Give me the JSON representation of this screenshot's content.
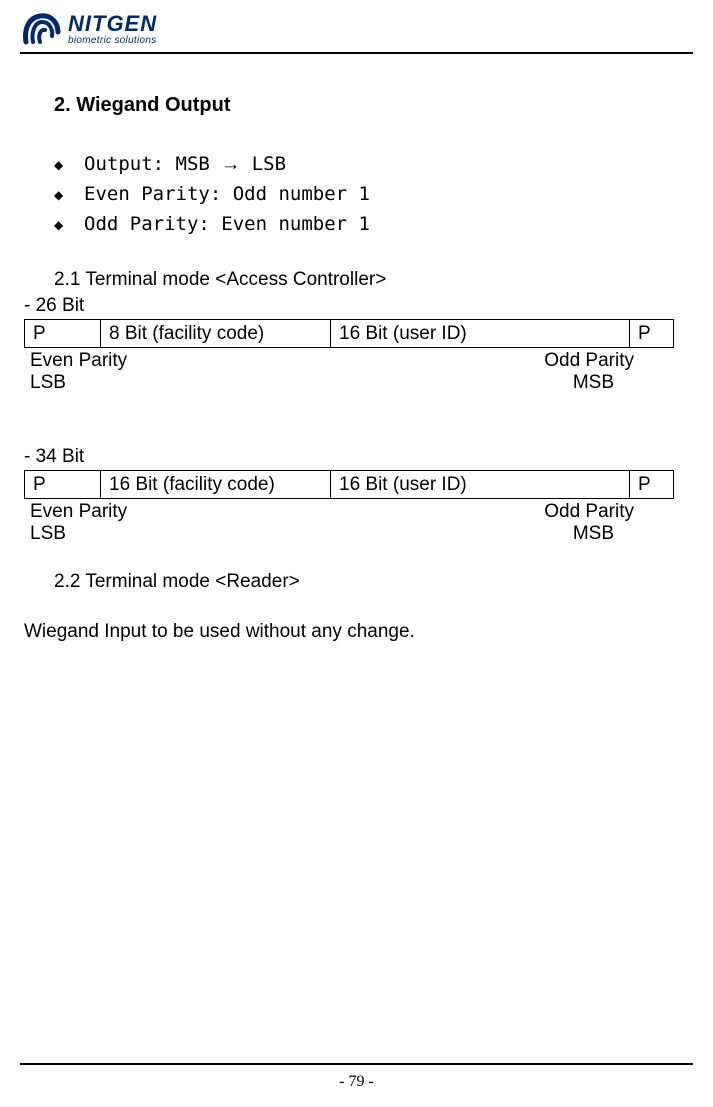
{
  "header": {
    "brand": "NITGEN",
    "slogan": "biometric solutions"
  },
  "section": {
    "title": "2.   Wiegand Output"
  },
  "bullets": [
    {
      "mark": "◆",
      "pre": "Output: MSB ",
      "arrow": "→",
      "post": " LSB"
    },
    {
      "mark": "◆",
      "pre": "Even Parity: Odd number 1",
      "arrow": "",
      "post": ""
    },
    {
      "mark": "◆",
      "pre": "Odd Parity: Even number 1",
      "arrow": "",
      "post": ""
    }
  ],
  "sub21": {
    "title": "2.1  Terminal mode <Access Controller>"
  },
  "block26": {
    "label": "- 26 Bit",
    "cells": {
      "p1": "P",
      "mid1": "8 Bit (facility code)",
      "mid2": "16 Bit (user ID)",
      "p2": "P"
    },
    "row1_left": "Even Parity",
    "row1_right": "Odd Parity",
    "row2_left": "LSB",
    "row2_right": "MSB"
  },
  "block34": {
    "label": "- 34 Bit",
    "cells": {
      "p1": "P",
      "mid1": "16 Bit (facility code)",
      "mid2": "16 Bit (user ID)",
      "p2": "P"
    },
    "row1_left": "Even Parity",
    "row1_right": "Odd Parity",
    "row2_left": "LSB",
    "row2_right": "MSB"
  },
  "sub22": {
    "title": "2.2  Terminal mode <Reader>"
  },
  "body_text": "Wiegand Input to be used without any change.",
  "page_number": "- 79 -"
}
